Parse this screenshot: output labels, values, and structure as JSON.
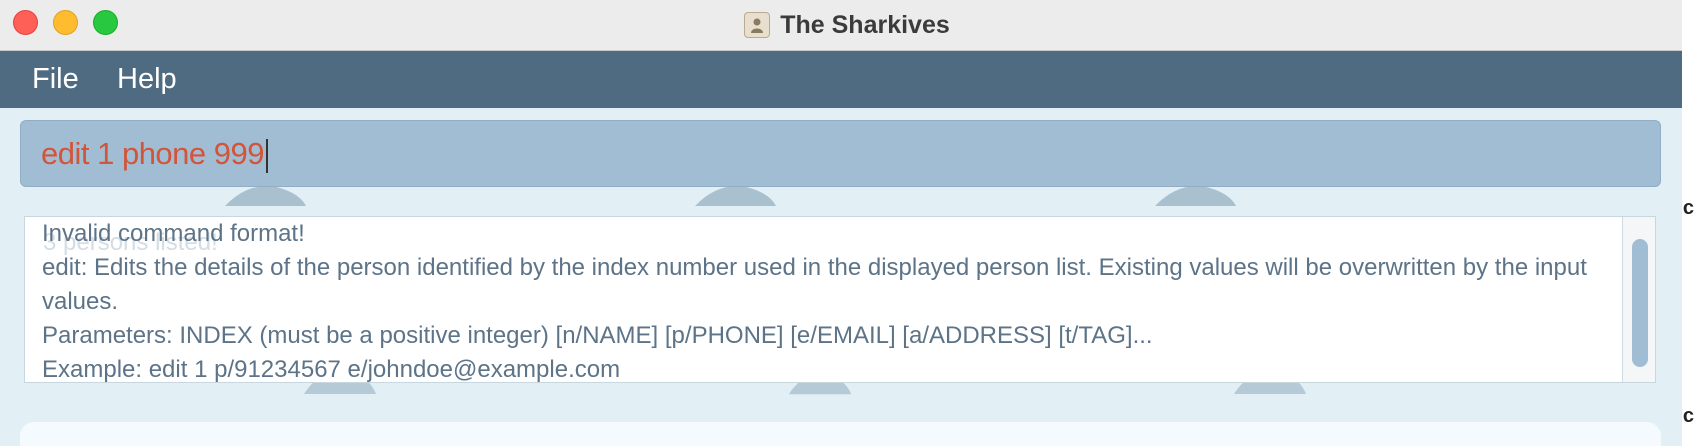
{
  "window": {
    "title": "The Sharkives",
    "controls": [
      "close",
      "minimize",
      "zoom"
    ]
  },
  "menu": {
    "items": [
      {
        "label": "File"
      },
      {
        "label": "Help"
      }
    ]
  },
  "command_box": {
    "value": "edit 1 phone 999"
  },
  "result_display": {
    "ghost_status": "3 persons listed!",
    "lines": [
      "Invalid command format!",
      "edit: Edits the details of the person identified by the index number used in the displayed person list. Existing values will be overwritten by the input",
      "values.",
      "Parameters: INDEX (must be a positive integer) [n/NAME] [p/PHONE] [e/EMAIL] [a/ADDRESS] [t/TAG]...",
      "Example: edit 1 p/91234567 e/johndoe@example.com"
    ]
  },
  "edge_glyphs": {
    "top": "c",
    "bottom": "c"
  },
  "colors": {
    "menubar": "#4e6b82",
    "command_box": "#a1bdd4",
    "command_text": "#d2553a",
    "result_text": "#5c7388",
    "background": "#e2f0f6"
  },
  "icons": {
    "app": "contacts-book-icon",
    "background_pattern": "shark-icon"
  }
}
